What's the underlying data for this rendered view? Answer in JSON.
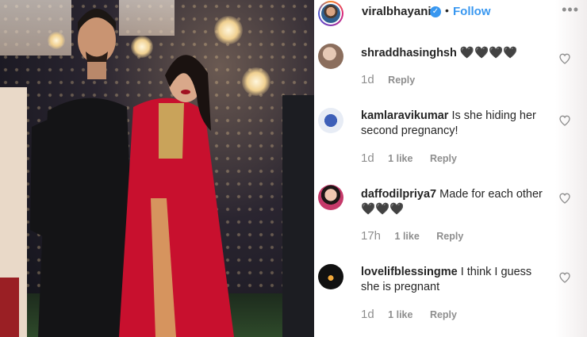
{
  "post": {
    "username": "viralbhayani",
    "follow_label": "Follow",
    "separator": "•",
    "more_label": "•••"
  },
  "comments": [
    {
      "username": "shraddhasinghsh",
      "text": "🖤🖤🖤🖤",
      "time": "1d",
      "likes": "",
      "reply_label": "Reply",
      "avatar_color": "#b89a86"
    },
    {
      "username": "kamlaravikumar",
      "text": "Is she hiding her second pregnancy!",
      "time": "1d",
      "likes": "1 like",
      "reply_label": "Reply",
      "avatar_color": "#3d5fb8"
    },
    {
      "username": "daffodilpriya7",
      "text": "Made for each other🖤🖤🖤",
      "time": "17h",
      "likes": "1 like",
      "reply_label": "Reply",
      "avatar_color": "#c53a6a"
    },
    {
      "username": "lovelifblessingme",
      "text": "I think I guess she is pregnant",
      "time": "1d",
      "likes": "1 like",
      "reply_label": "Reply",
      "avatar_color": "#111111"
    }
  ],
  "colors": {
    "accent": "#3897f0",
    "text": "#262626",
    "muted": "#8e8e8e"
  }
}
